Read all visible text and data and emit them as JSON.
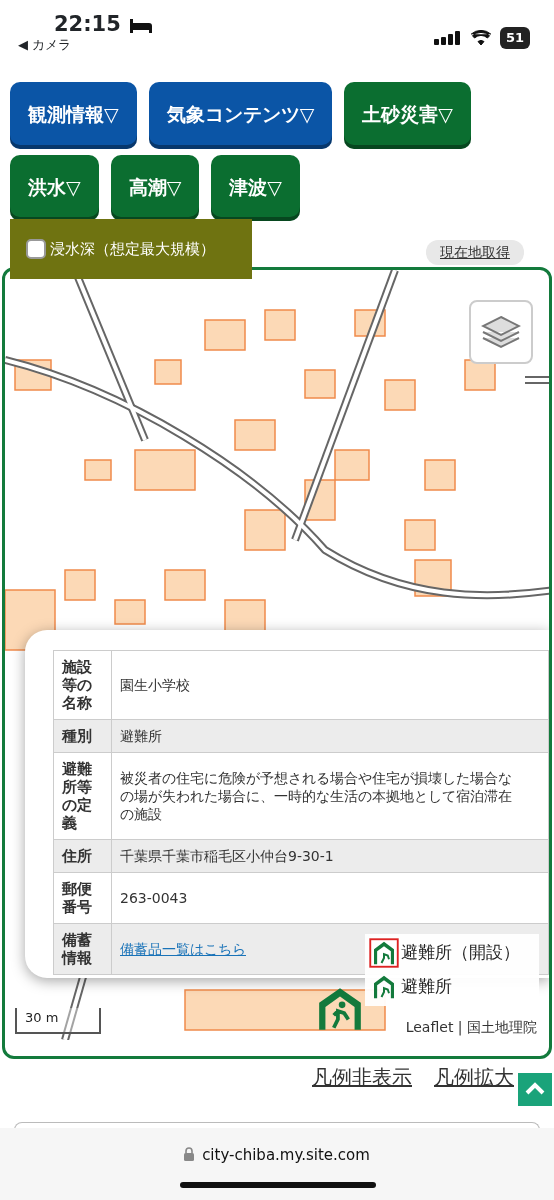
{
  "status_bar": {
    "time": "22:15",
    "back_label": "◀ カメラ",
    "battery": "51"
  },
  "menu_buttons": [
    {
      "label": "観測情報▽",
      "color": "#0b55a6"
    },
    {
      "label": "気象コンテンツ▽",
      "color": "#0b55a6"
    },
    {
      "label": "土砂災害▽",
      "color": "#0b6e30"
    },
    {
      "label": "洪水▽",
      "color": "#0b6e30"
    },
    {
      "label": "高潮▽",
      "color": "#0b6e30"
    },
    {
      "label": "津波▽",
      "color": "#0b6e30"
    }
  ],
  "layer_option": {
    "label": "浸水深（想定最大規模）",
    "checked": false
  },
  "locate_button": "現在地取得",
  "popup": {
    "rows": [
      {
        "header": "施設等の名称",
        "value": "園生小学校",
        "kind": "text"
      },
      {
        "header": "種別",
        "value": "避難所",
        "kind": "text"
      },
      {
        "header": "避難所等の定義",
        "lines": [
          "被災者の住宅に危険が予想される場合や住宅が損壊した場合な",
          "の場が失われた場合に、一時的な生活の本拠地として宿泊滞在",
          "の施設"
        ],
        "kind": "multiline"
      },
      {
        "header": "住所",
        "value": "千葉県千葉市稲毛区小仲台9-30-1",
        "kind": "text"
      },
      {
        "header": "郵便番号",
        "value": "263-0043",
        "kind": "text"
      },
      {
        "header": "備蓄情報",
        "value": "備蓄品一覧はこちら",
        "kind": "link"
      }
    ]
  },
  "legend": [
    {
      "label": "避難所（開設）",
      "kind": "open"
    },
    {
      "label": "避難所",
      "kind": "normal"
    }
  ],
  "scale": "30 m",
  "attribution": [
    "Leaflet",
    "国土地理院"
  ],
  "attribution_separator": "|",
  "legend_links": [
    "凡例非表示",
    "凡例拡大"
  ],
  "url": "city-chiba.my.site.com"
}
